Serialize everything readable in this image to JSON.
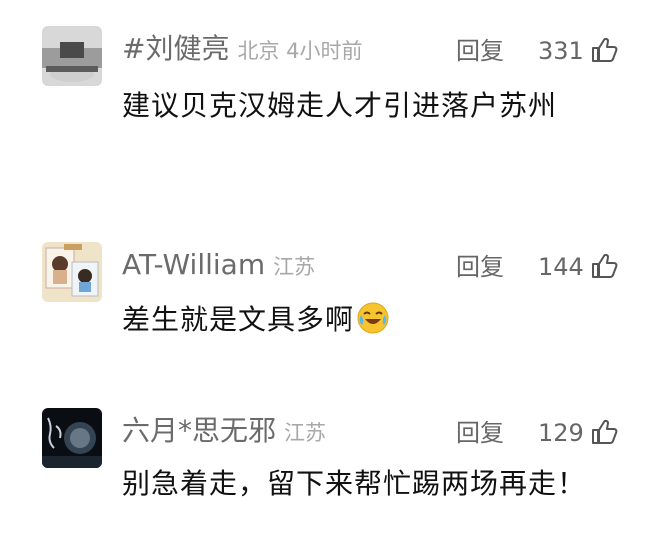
{
  "comments": [
    {
      "name": "#刘健亮",
      "location": "北京 4小时前",
      "reply_label": "回复",
      "likes": "331",
      "text": "建议贝克汉姆走人才引进落户苏州"
    },
    {
      "name": "AT-William",
      "location": "江苏",
      "reply_label": "回复",
      "likes": "144",
      "text": "差生就是文具多啊",
      "emoji": "crying-laughing-emoji"
    },
    {
      "name": "六月*思无邪",
      "location": "江苏",
      "reply_label": "回复",
      "likes": "129",
      "text": "别急着走，留下来帮忙踢两场再走！"
    }
  ],
  "icons": {
    "like": "thumbs-up-icon"
  },
  "colors": {
    "name": "#6b6b6b",
    "location": "#a8a8a8",
    "text": "#111111",
    "emoji": "#f6c42f"
  }
}
